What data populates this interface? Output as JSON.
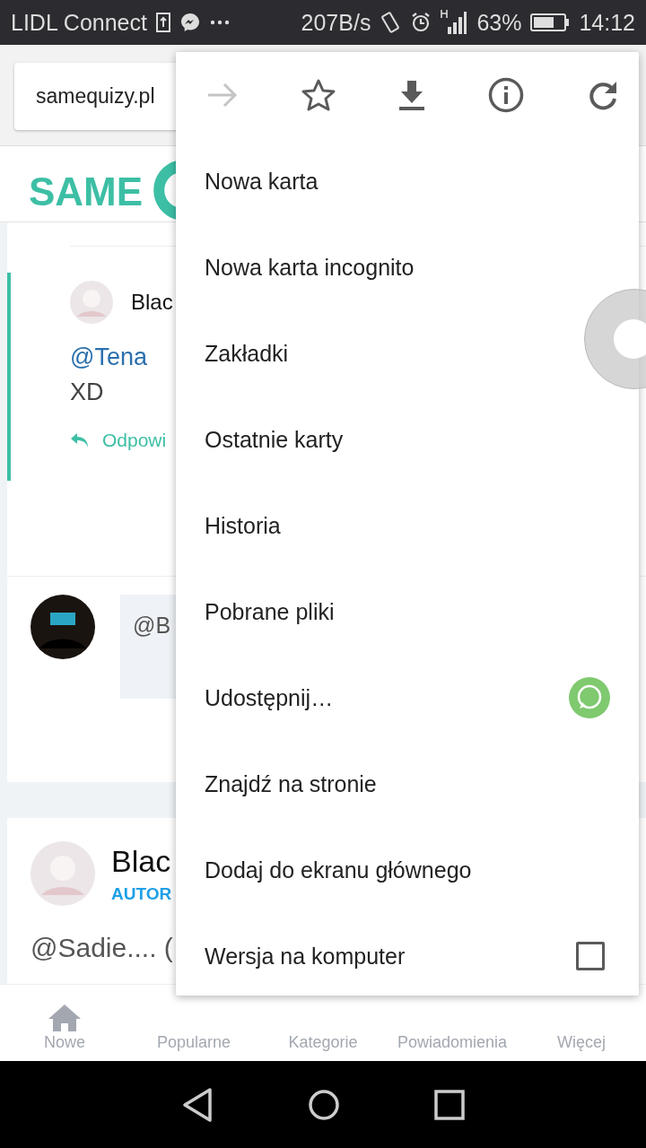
{
  "status_bar": {
    "carrier": "LIDL Connect",
    "speed": "207B/s",
    "battery": "63%",
    "time": "14:12"
  },
  "browser": {
    "url": "samequizy.pl"
  },
  "site": {
    "logo": "SAME"
  },
  "thread": {
    "reply": {
      "author": "Blac",
      "mention": "@Tena",
      "text": "XD",
      "reply_link": "Odpowi"
    },
    "comment": {
      "text": "@B"
    }
  },
  "post": {
    "author": "Blac",
    "badge": "AUTOR",
    "text": "@Sadie.... ("
  },
  "bottom_nav": [
    {
      "label": "Nowe",
      "kind": "home"
    },
    {
      "label": "Popularne"
    },
    {
      "label": "Kategorie"
    },
    {
      "label": "Powiadomienia"
    },
    {
      "label": "Więcej"
    }
  ],
  "menu": {
    "actions": [
      {
        "kind": "forward",
        "disabled": true
      },
      {
        "kind": "bookmark",
        "disabled": false
      },
      {
        "kind": "download",
        "disabled": false
      },
      {
        "kind": "info",
        "disabled": false
      },
      {
        "kind": "reload",
        "disabled": false
      }
    ],
    "items": [
      {
        "label": "Nowa karta"
      },
      {
        "label": "Nowa karta incognito"
      },
      {
        "label": "Zakładki"
      },
      {
        "label": "Ostatnie karty"
      },
      {
        "label": "Historia"
      },
      {
        "label": "Pobrane pliki"
      },
      {
        "label": "Udostępnij…",
        "kind": "share"
      },
      {
        "label": "Znajdź na stronie"
      },
      {
        "label": "Dodaj do ekranu głównego"
      },
      {
        "label": "Wersja na komputer",
        "kind": "checkbox",
        "checked": false
      }
    ]
  }
}
